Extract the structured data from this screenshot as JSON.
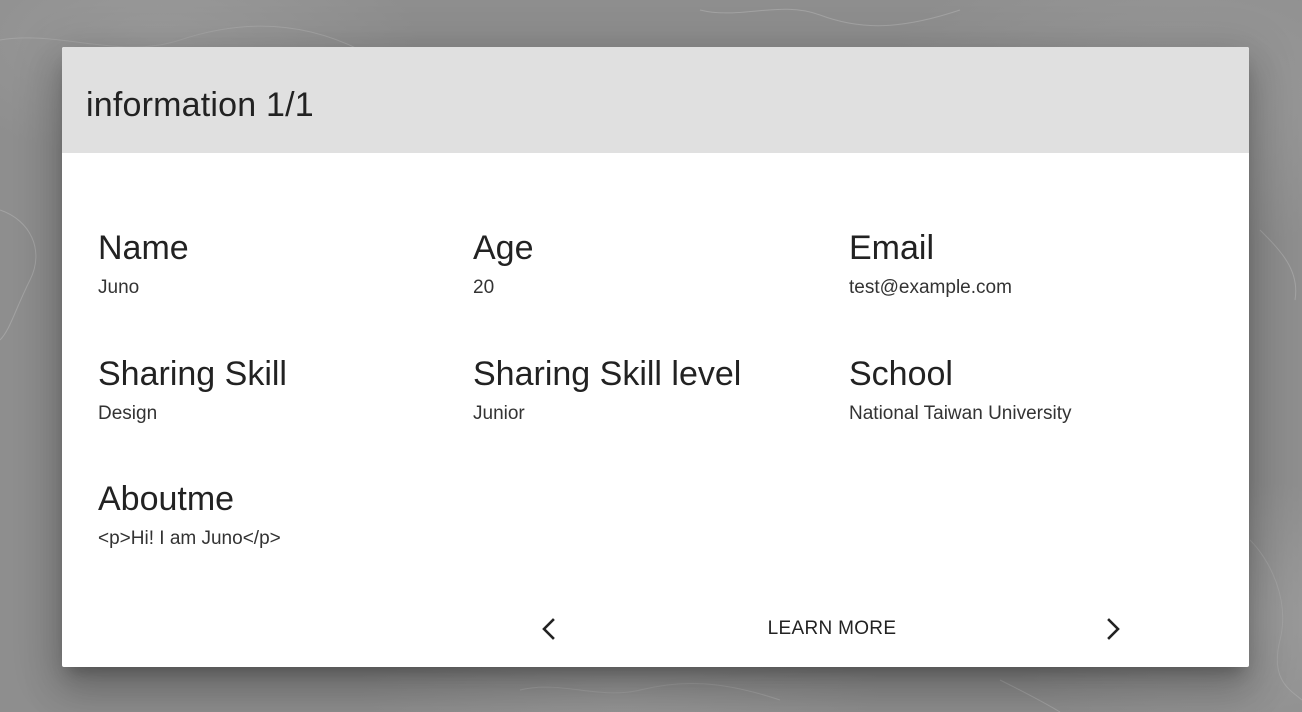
{
  "dialog": {
    "title": "information 1/1"
  },
  "fields": [
    {
      "label": "Name",
      "value": "Juno"
    },
    {
      "label": "Age",
      "value": "20"
    },
    {
      "label": "Email",
      "value": "test@example.com"
    },
    {
      "label": "Sharing Skill",
      "value": "Design"
    },
    {
      "label": "Sharing Skill level",
      "value": "Junior"
    },
    {
      "label": "School",
      "value": "National Taiwan University"
    },
    {
      "label": "Aboutme",
      "value": "<p>Hi! I am Juno</p>"
    }
  ],
  "actions": {
    "learn_more": "LEARN MORE",
    "prev_icon": "chevron-left-icon",
    "next_icon": "chevron-right-icon"
  },
  "colors": {
    "header_bg": "#e0e0e0",
    "dialog_bg": "#ffffff",
    "overlay": "#8e8e8e",
    "text": "#222222"
  }
}
